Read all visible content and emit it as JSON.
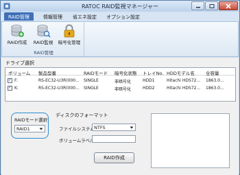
{
  "window": {
    "title": "RATOC RAID監視マネージャー"
  },
  "menu": {
    "items": [
      "RAID管理",
      "情報管理",
      "省エネ設定",
      "オプション設定"
    ]
  },
  "ribbon": {
    "buttons": [
      {
        "label": "RAID作成",
        "icon": "raid-create-icon"
      },
      {
        "label": "RAID監視",
        "icon": "raid-monitor-icon"
      },
      {
        "label": "暗号化管理",
        "icon": "padlock-icon"
      }
    ],
    "group_label": "RAID管理"
  },
  "drive_selection": {
    "label": "ドライブ選択",
    "columns": [
      "ボリューム",
      "製品型番",
      "RAIDモード",
      "暗号化状態",
      "トレイNo.",
      "HDDモデル名",
      "全容量"
    ],
    "rows": [
      {
        "checked": true,
        "volume": "F:",
        "product": "RS-EC32-U3R(000...",
        "raid_mode": "SINGLE",
        "encryption": "非暗号化",
        "tray": "HDD1",
        "model": "Hitachi HDS72...",
        "capacity": "1863.0..."
      },
      {
        "checked": true,
        "volume": "K:",
        "product": "RS-EC32-U3R(000...",
        "raid_mode": "SINGLE",
        "encryption": "非暗号化",
        "tray": "HDD2",
        "model": "Hitachi HDS72...",
        "capacity": "1863.0..."
      }
    ]
  },
  "raid_mode": {
    "label": "RAIDモード選択",
    "selected": "RAID1"
  },
  "format": {
    "label": "ディスクのフォーマット",
    "filesystem_label": "ファイルシステム",
    "filesystem_value": "NTFS",
    "volume_label_label": "ボリュームラベル",
    "volume_label_value": ""
  },
  "actions": {
    "create_label": "RAID作成"
  },
  "colors": {
    "accent": "#2b8cd4",
    "menu_active": "#3f6fb8",
    "window_frame": "#c9dbef"
  }
}
